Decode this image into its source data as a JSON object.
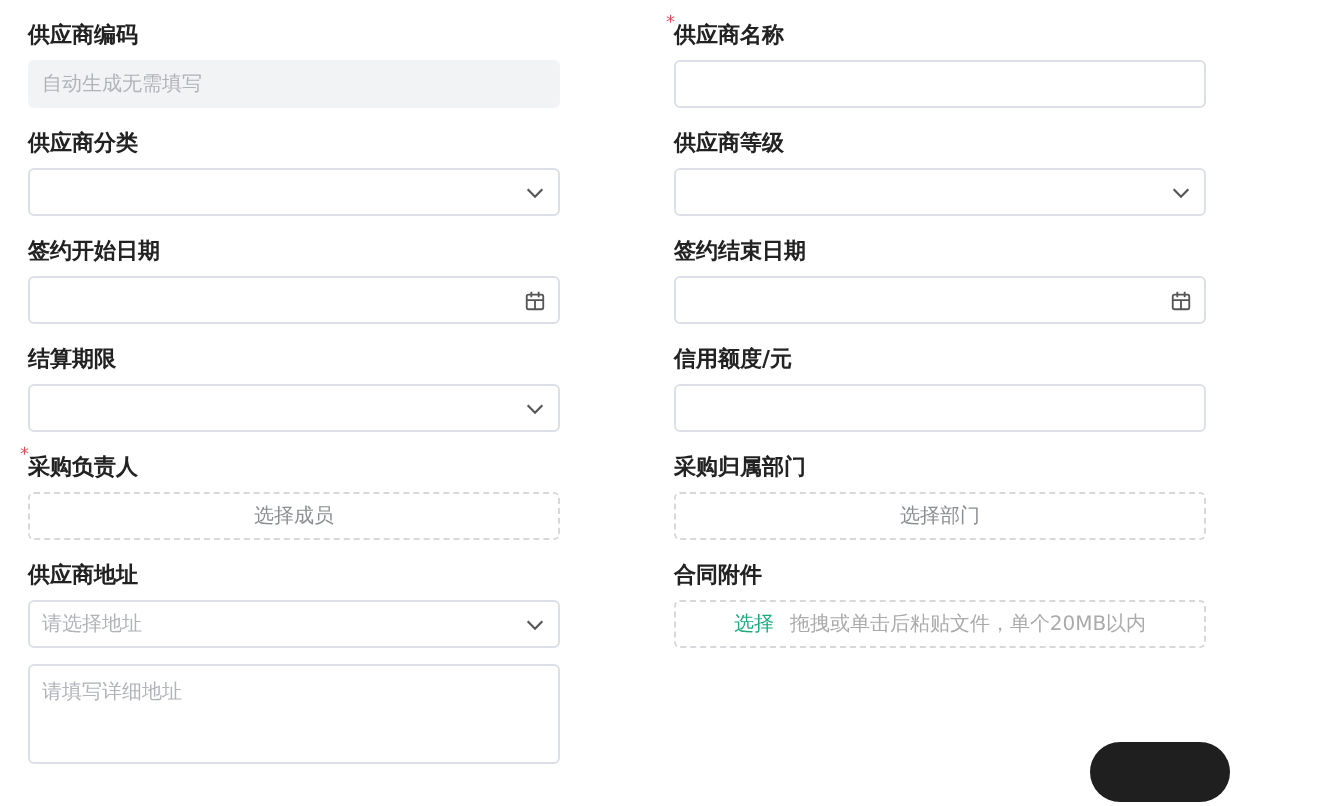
{
  "fields": [
    {
      "label": "供应商编码",
      "kind": "input",
      "disabled": true,
      "placeholder": "自动生成无需填写"
    },
    {
      "label": "供应商名称",
      "required_mark": "*",
      "kind": "input",
      "disabled": false
    },
    {
      "label": "供应商分类",
      "kind": "select"
    },
    {
      "label": "供应商等级",
      "kind": "select"
    },
    {
      "label": "签约开始日期",
      "kind": "date"
    },
    {
      "label": "签约结束日期",
      "kind": "date"
    },
    {
      "label": "结算期限",
      "kind": "select"
    },
    {
      "label": "信用额度/元",
      "kind": "input",
      "disabled": false
    },
    {
      "label": "采购负责人",
      "required_mark": "*",
      "kind": "picker",
      "text": "选择成员"
    },
    {
      "label": "采购归属部门",
      "kind": "picker",
      "text": "选择部门"
    },
    {
      "label": "供应商地址",
      "kind": "address",
      "placeholder": "请选择地址",
      "detail_placeholder": "请填写详细地址"
    },
    {
      "label": "合同附件",
      "kind": "upload",
      "link": "选择",
      "hint": "拖拽或单击后粘贴文件，单个20MB以内"
    }
  ]
}
